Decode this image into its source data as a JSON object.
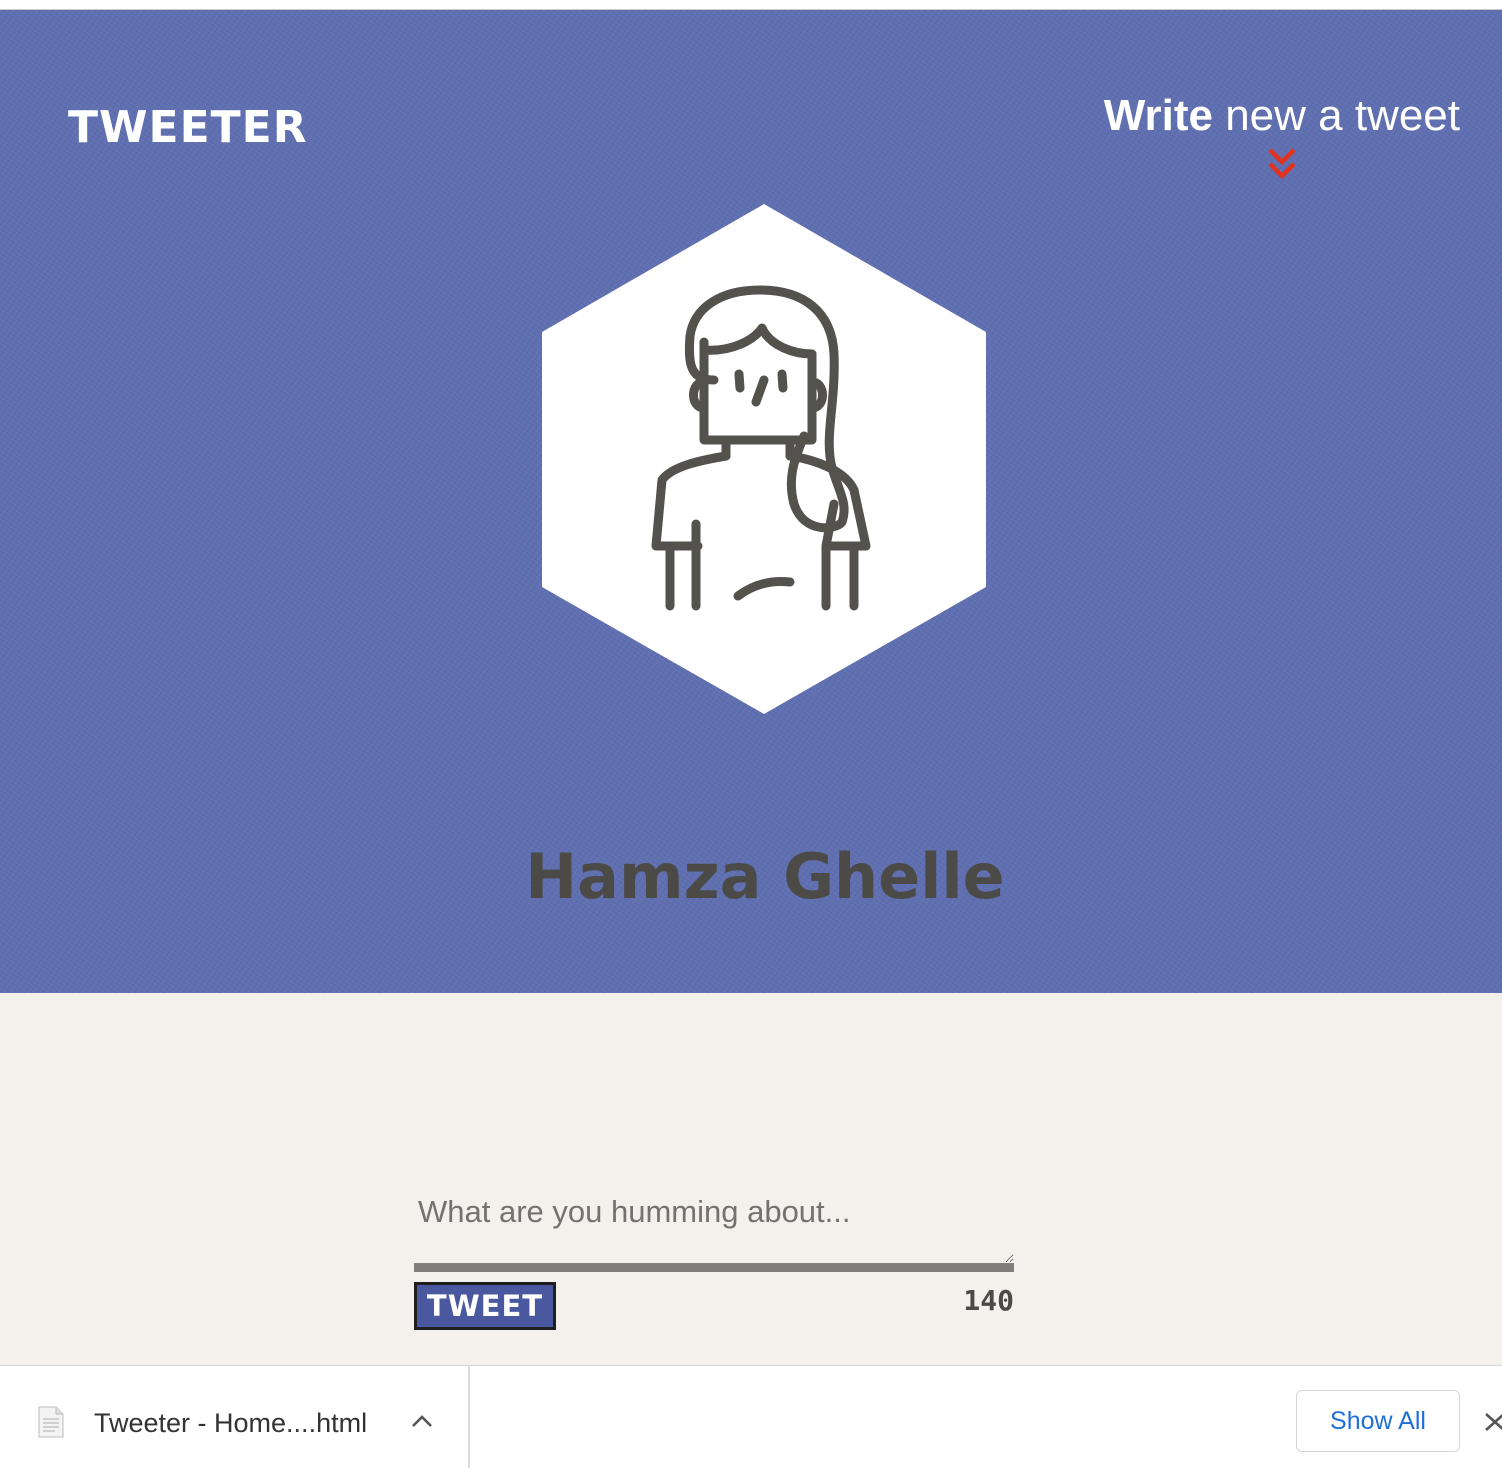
{
  "header": {
    "logo": "TWEETER",
    "compose_strong": "Write",
    "compose_rest": "new a tweet",
    "chevron_color": "#e0321e",
    "background_color": "#5f6fb0"
  },
  "profile": {
    "avatar_icon": "woman-avatar-icon",
    "name": "Hamza Ghelle"
  },
  "composer": {
    "placeholder": "What are you humming about...",
    "value": "",
    "button_label": "TWEET",
    "counter": "140"
  },
  "download_bar": {
    "file_name": "Tweeter - Home....html",
    "show_all_label": "Show All"
  }
}
